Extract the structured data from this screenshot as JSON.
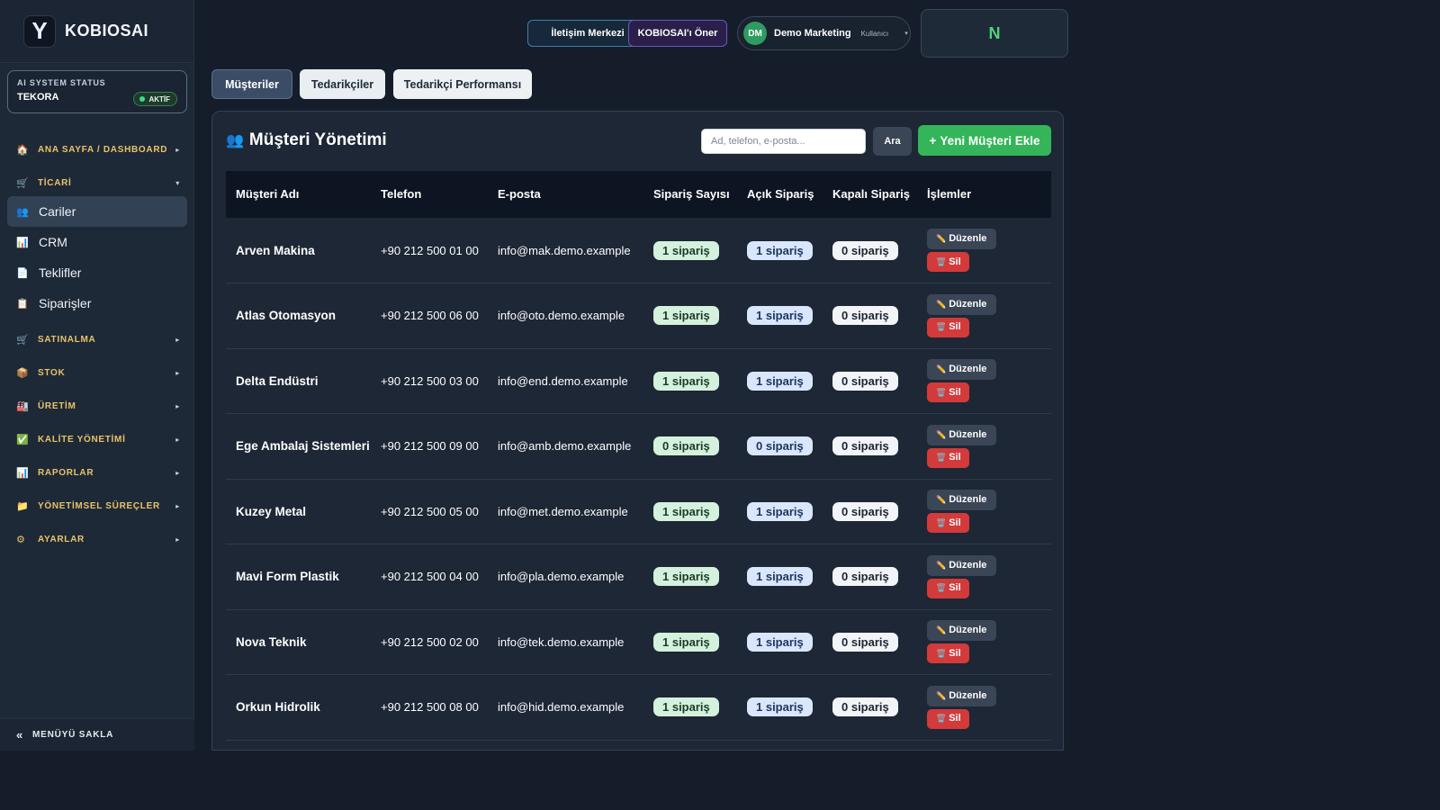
{
  "brand": {
    "logo_letter": "Y",
    "name": "KOBIOSAI"
  },
  "ai_status": {
    "label": "AI SYSTEM STATUS",
    "company": "TEKORA",
    "badge": "AKTİF"
  },
  "sidebar": {
    "sections": [
      {
        "icon": "home-icon",
        "glyph": "🏠",
        "label": "ANA SAYFA / DASHBOARD",
        "arrow": "▸"
      },
      {
        "icon": "commerce-icon",
        "glyph": "🛒",
        "label": "TİCARİ",
        "arrow": "▾"
      },
      {
        "icon": "cart-icon",
        "glyph": "🛒",
        "label": "SATINALMA",
        "arrow": "▸"
      },
      {
        "icon": "box-icon",
        "glyph": "📦",
        "label": "STOK",
        "arrow": "▸"
      },
      {
        "icon": "factory-icon",
        "glyph": "🏭",
        "label": "ÜRETİM",
        "arrow": "▸"
      },
      {
        "icon": "check-icon",
        "glyph": "✅",
        "label": "KALİTE YÖNETİMİ",
        "arrow": "▸"
      },
      {
        "icon": "chart-icon",
        "glyph": "📊",
        "label": "RAPORLAR",
        "arrow": "▸"
      },
      {
        "icon": "folder-icon",
        "glyph": "📁",
        "label": "YÖNETİMSEL SÜREÇLER",
        "arrow": "▸"
      },
      {
        "icon": "gear-icon",
        "glyph": "⚙",
        "label": "AYARLAR",
        "arrow": "▸"
      }
    ],
    "items": [
      {
        "icon": "users-icon",
        "glyph": "👥",
        "label": "Cariler"
      },
      {
        "icon": "chart-icon",
        "glyph": "📊",
        "label": "CRM"
      },
      {
        "icon": "document-icon",
        "glyph": "📄",
        "label": "Teklifler"
      },
      {
        "icon": "clipboard-icon",
        "glyph": "📋",
        "label": "Siparişler"
      }
    ],
    "footer": {
      "icon": "«",
      "label": "MENÜYÜ SAKLA"
    }
  },
  "topbar": {
    "iletisim": "İletişim Merkezi",
    "oner": "KOBIOSAI'ı Öner",
    "user": {
      "initials": "DM",
      "name": "Demo Marketing",
      "role": "Kullanıcı",
      "caret": "▾"
    },
    "box_letter": "N"
  },
  "tabs": [
    "Müşteriler",
    "Tedarikçiler",
    "Tedarikçi Performansı"
  ],
  "panel": {
    "icon": "👥",
    "title": "Müşteri Yönetimi",
    "search_placeholder": "Ad, telefon, e-posta...",
    "search_button": "Ara",
    "new_button": "Yeni Müşteri Ekle",
    "new_button_icon": "+"
  },
  "table": {
    "columns": [
      "Müşteri Adı",
      "Telefon",
      "E-posta",
      "Sipariş Sayısı",
      "Açık Sipariş",
      "Kapalı Sipariş",
      "İşlemler"
    ],
    "edit_label": "Düzenle",
    "delete_label": "Sil",
    "rows": [
      {
        "name": "Arven Makina",
        "phone": "+90 212 500 01 00",
        "email": "info@mak.demo.example",
        "orders": "1 sipariş",
        "open": "1 sipariş",
        "closed": "0 sipariş"
      },
      {
        "name": "Atlas Otomasyon",
        "phone": "+90 212 500 06 00",
        "email": "info@oto.demo.example",
        "orders": "1 sipariş",
        "open": "1 sipariş",
        "closed": "0 sipariş"
      },
      {
        "name": "Delta Endüstri",
        "phone": "+90 212 500 03 00",
        "email": "info@end.demo.example",
        "orders": "1 sipariş",
        "open": "1 sipariş",
        "closed": "0 sipariş"
      },
      {
        "name": "Ege Ambalaj Sistemleri",
        "phone": "+90 212 500 09 00",
        "email": "info@amb.demo.example",
        "orders": "0 sipariş",
        "open": "0 sipariş",
        "closed": "0 sipariş"
      },
      {
        "name": "Kuzey Metal",
        "phone": "+90 212 500 05 00",
        "email": "info@met.demo.example",
        "orders": "1 sipariş",
        "open": "1 sipariş",
        "closed": "0 sipariş"
      },
      {
        "name": "Mavi Form Plastik",
        "phone": "+90 212 500 04 00",
        "email": "info@pla.demo.example",
        "orders": "1 sipariş",
        "open": "1 sipariş",
        "closed": "0 sipariş"
      },
      {
        "name": "Nova Teknik",
        "phone": "+90 212 500 02 00",
        "email": "info@tek.demo.example",
        "orders": "1 sipariş",
        "open": "1 sipariş",
        "closed": "0 sipariş"
      },
      {
        "name": "Orkun Hidrolik",
        "phone": "+90 212 500 08 00",
        "email": "info@hid.demo.example",
        "orders": "1 sipariş",
        "open": "1 sipariş",
        "closed": "0 sipariş"
      }
    ]
  },
  "colors": {
    "accent_green": "#34b55a",
    "section_gold": "#e8c36a",
    "danger": "#d33a3a",
    "bg": "#151d2b"
  }
}
